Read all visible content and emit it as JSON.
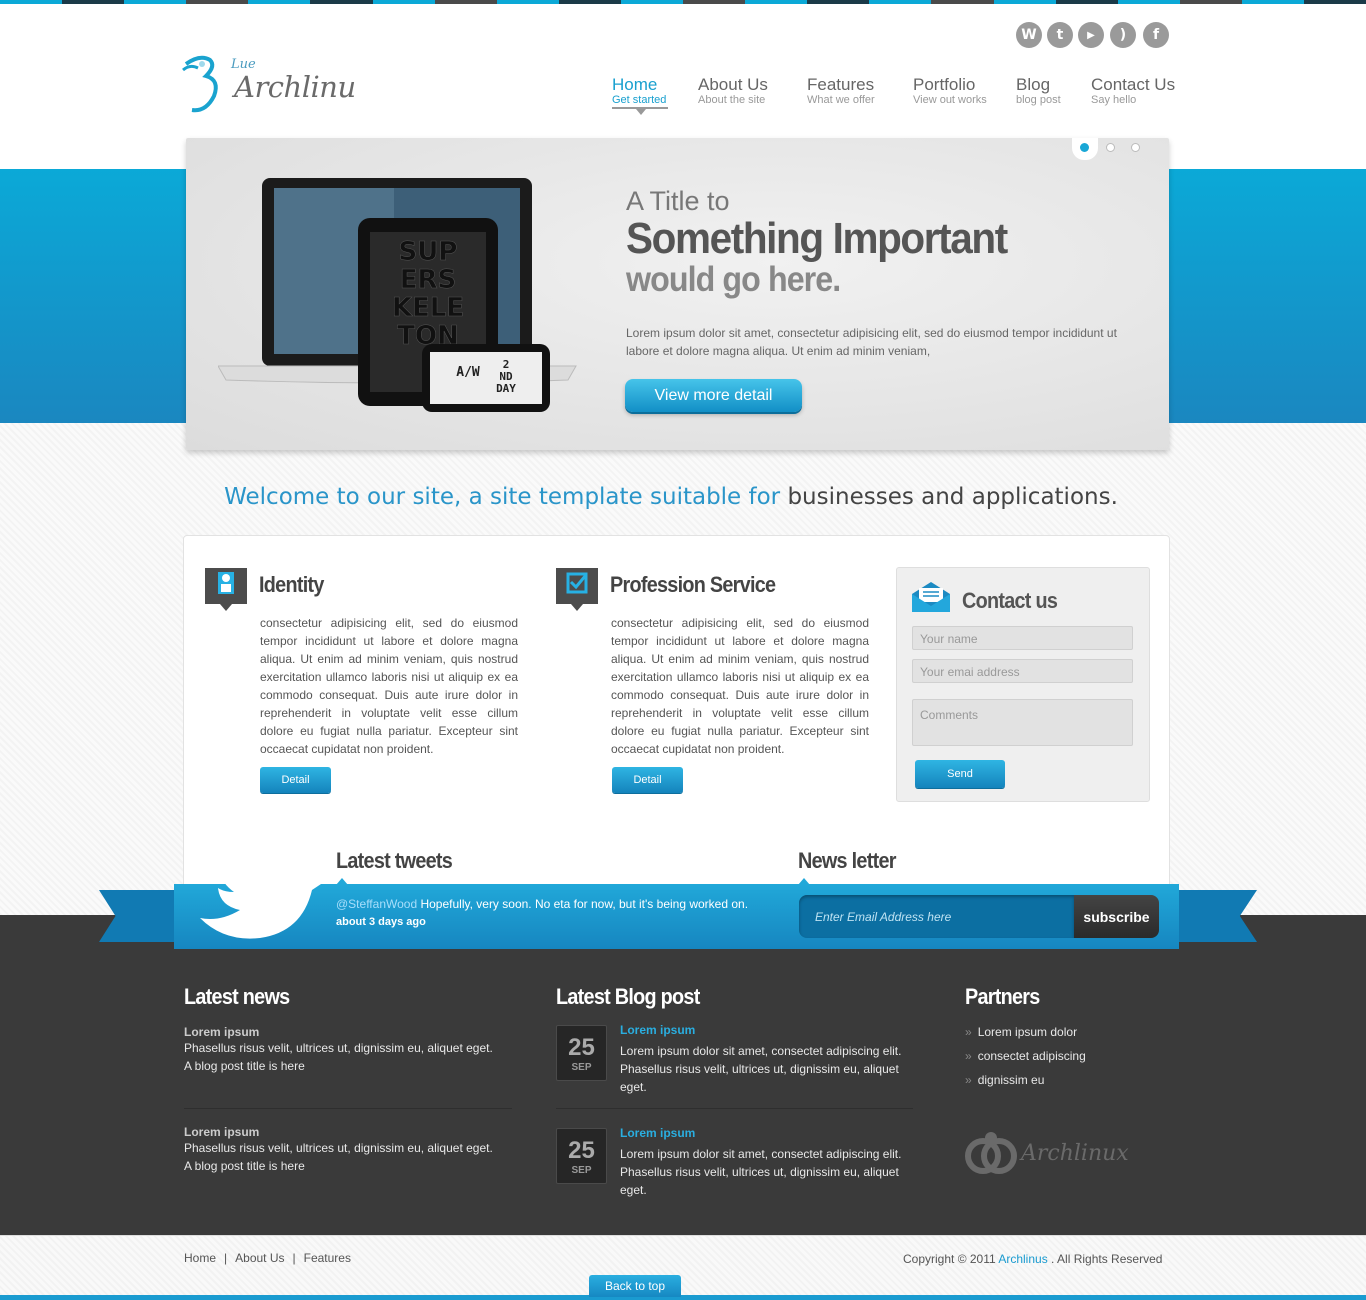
{
  "colors": {
    "accent": "#1a9bd0",
    "stripes": [
      "#0ba9d7",
      "#1b3a48",
      "#0ba9d7",
      "#4a4a4a",
      "#0ba9d7",
      "#1b3a48",
      "#0ba9d7",
      "#4a4a4a",
      "#0ba9d7",
      "#1b3a48",
      "#0ba9d7",
      "#4a4a4a",
      "#0ba9d7",
      "#1b3a48",
      "#0ba9d7",
      "#4a4a4a",
      "#0ba9d7",
      "#1b3a48",
      "#0ba9d7",
      "#4a4a4a",
      "#0ba9d7",
      "#1b3a48"
    ]
  },
  "social": [
    {
      "icon": "wordpress-icon",
      "glyph": "W"
    },
    {
      "icon": "twitter-icon",
      "glyph": "t"
    },
    {
      "icon": "youtube-icon",
      "glyph": "▶"
    },
    {
      "icon": "rss-icon",
      "glyph": ")"
    },
    {
      "icon": "facebook-icon",
      "glyph": "f"
    }
  ],
  "logo": {
    "small": "Lue",
    "big": "Archlinu"
  },
  "nav": [
    {
      "label": "Home",
      "sub": "Get started"
    },
    {
      "label": "About Us",
      "sub": "About the site"
    },
    {
      "label": "Features",
      "sub": "What we offer"
    },
    {
      "label": "Portfolio",
      "sub": "View out works"
    },
    {
      "label": "Blog",
      "sub": "blog post"
    },
    {
      "label": "Contact Us",
      "sub": "Say hello"
    }
  ],
  "slider": {
    "title1": "A Title to",
    "title2": "Something Important",
    "title3": "would go here.",
    "body": "Lorem ipsum dolor sit amet, consectetur adipisicing elit, sed do eiusmod tempor incididunt ut labore et dolore magna aliqua. Ut enim ad minim veniam,",
    "button": "View more detail",
    "device_text_tablet": "SUPERSKELETON",
    "device_text_phone": "A/W 2ND DAY"
  },
  "welcome": {
    "part1": "Welcome to our site, a site template suitable for ",
    "part2": "businesses and applications."
  },
  "features": [
    {
      "title": "Identity",
      "icon": "identity-icon",
      "text": "consectetur adipisicing elit, sed do eiusmod tempor incididunt ut labore et dolore magna aliqua. Ut enim ad minim veniam, quis nostrud exercitation ullamco laboris nisi ut aliquip ex ea commodo consequat. Duis aute irure dolor in reprehenderit in voluptate velit esse cillum dolore eu fugiat nulla pariatur. Excepteur sint occaecat cupidatat non proident.",
      "button": "Detail"
    },
    {
      "title": "Profession Service",
      "icon": "checkmark-icon",
      "text": "consectetur adipisicing elit, sed do eiusmod tempor incididunt ut labore et dolore magna aliqua. Ut enim ad minim veniam, quis nostrud exercitation ullamco laboris nisi ut aliquip ex ea commodo consequat. Duis aute irure dolor in reprehenderit in voluptate velit esse cillum dolore eu fugiat nulla pariatur. Excepteur sint occaecat cupidatat non proident.",
      "button": "Detail"
    }
  ],
  "contact": {
    "title": "Contact us",
    "name_placeholder": "Your name",
    "email_placeholder": "Your emai address",
    "comments_placeholder": "Comments",
    "send": "Send"
  },
  "tweets": {
    "title": "Latest tweets",
    "handle": "@SteffanWood",
    "text": " Hopefully, very soon. No eta for now, but it's being worked on.",
    "time": "about 3 days ago"
  },
  "newsletter": {
    "title": "News letter",
    "placeholder": "Enter Email Address here",
    "button": "subscribe"
  },
  "latest_news": {
    "title": "Latest news",
    "items": [
      {
        "title": "Lorem ipsum",
        "line1": "Phasellus risus velit, ultrices ut, dignissim eu, aliquet eget.",
        "line2": "A blog post title is here"
      },
      {
        "title": "Lorem ipsum",
        "line1": "Phasellus risus velit, ultrices ut, dignissim eu, aliquet eget.",
        "line2": "A blog post title is here"
      }
    ]
  },
  "blog": {
    "title": "Latest Blog post",
    "items": [
      {
        "day": "25",
        "month": "SEP",
        "title": "Lorem ipsum",
        "text": "Lorem ipsum dolor sit amet, consectet adipiscing elit. Phasellus risus velit, ultrices ut, dignissim eu, aliquet eget."
      },
      {
        "day": "25",
        "month": "SEP",
        "title": "Lorem ipsum",
        "text": "Lorem ipsum dolor sit amet, consectet adipiscing elit. Phasellus risus velit, ultrices ut, dignissim eu, aliquet eget."
      }
    ]
  },
  "partners": {
    "title": "Partners",
    "items": [
      "Lorem ipsum dolor",
      "consectet adipiscing",
      "dignissim eu"
    ],
    "logo": "Archlinux"
  },
  "footer": {
    "links": [
      "Home",
      "About Us",
      "Features"
    ],
    "copyright_pre": "Copyright © 2011 ",
    "copyright_brand": "Archlinus",
    "copyright_post": " . All Rights Reserved",
    "back_top": "Back to top"
  }
}
